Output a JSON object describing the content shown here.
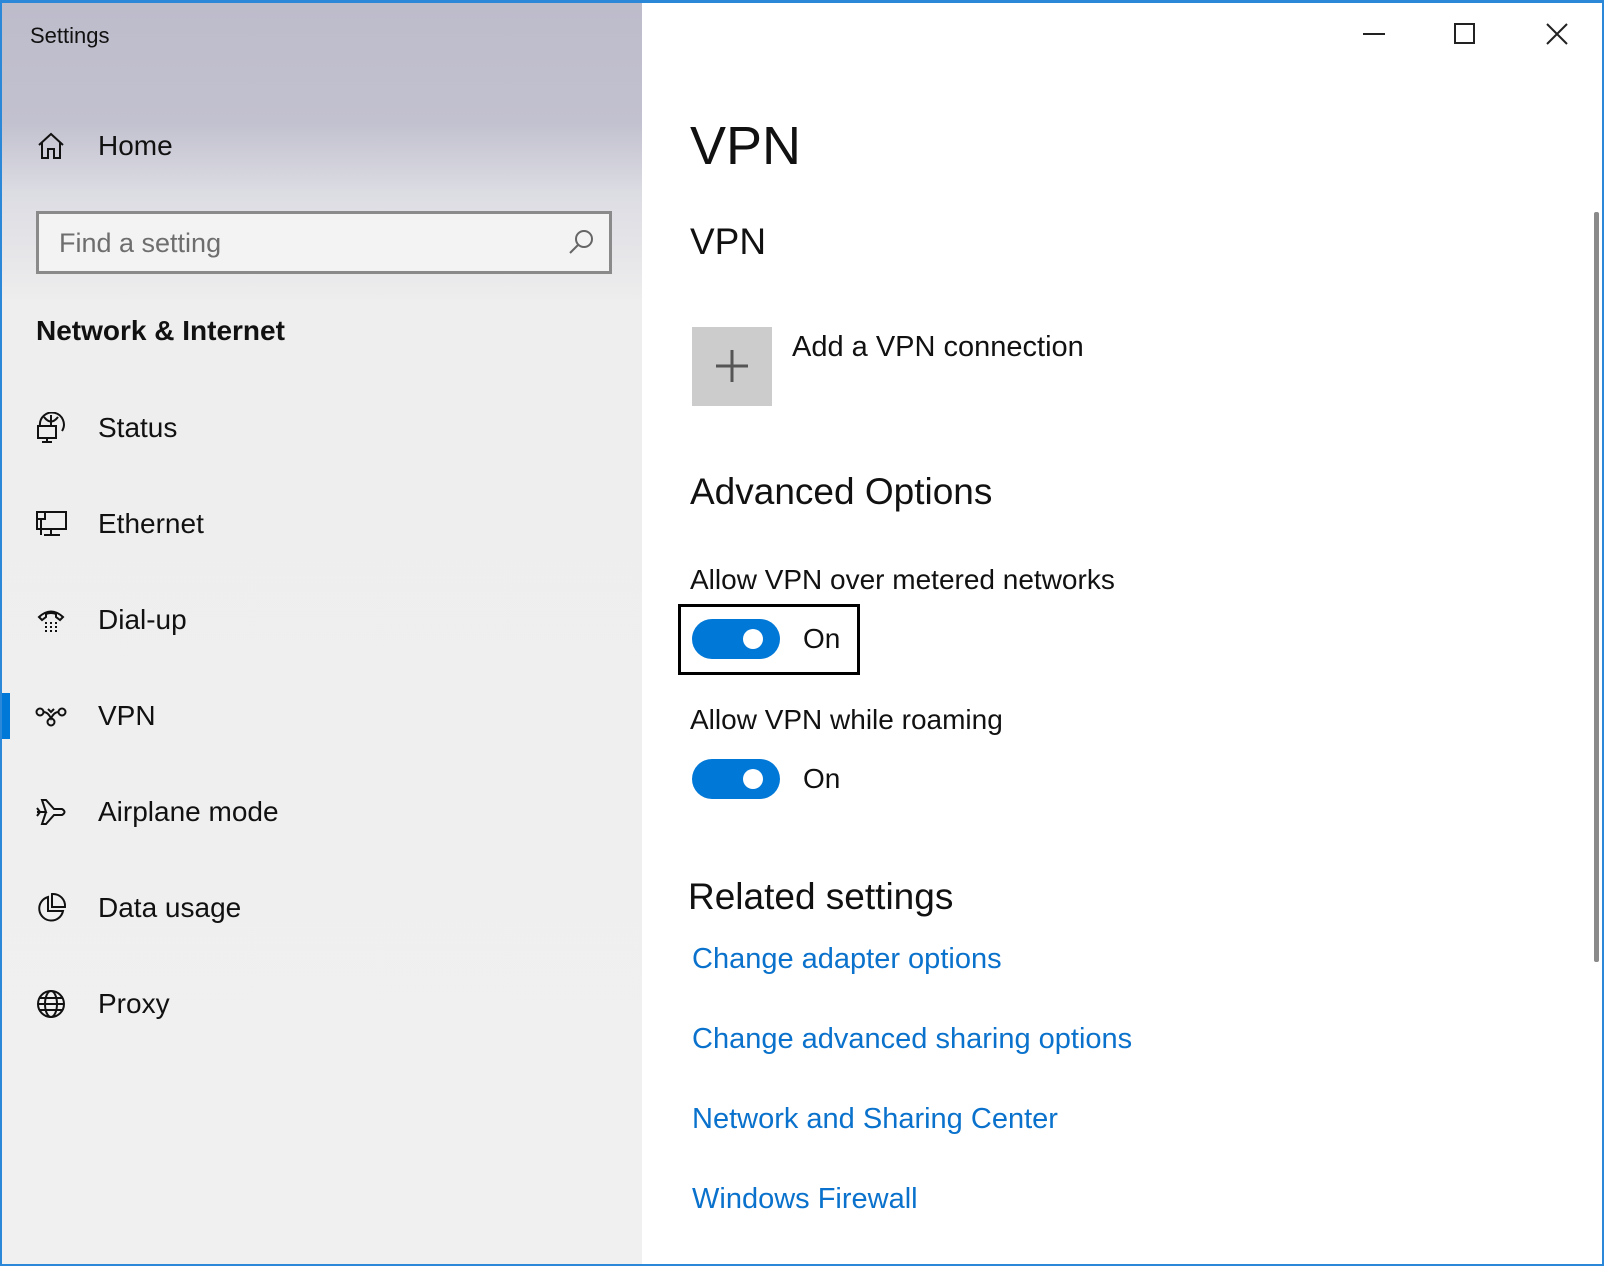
{
  "window": {
    "title": "Settings",
    "controls": {
      "minimize": "minimize-icon",
      "maximize": "maximize-icon",
      "close": "close-icon"
    }
  },
  "sidebar": {
    "home": {
      "label": "Home",
      "icon": "home-icon"
    },
    "search": {
      "placeholder": "Find a setting",
      "value": "",
      "icon": "search-icon"
    },
    "section_title": "Network & Internet",
    "items": [
      {
        "label": "Status",
        "icon": "status-globe-icon",
        "selected": false
      },
      {
        "label": "Ethernet",
        "icon": "ethernet-icon",
        "selected": false
      },
      {
        "label": "Dial-up",
        "icon": "dialup-phone-icon",
        "selected": false
      },
      {
        "label": "VPN",
        "icon": "vpn-icon",
        "selected": true
      },
      {
        "label": "Airplane mode",
        "icon": "airplane-icon",
        "selected": false
      },
      {
        "label": "Data usage",
        "icon": "data-usage-icon",
        "selected": false
      },
      {
        "label": "Proxy",
        "icon": "globe-icon",
        "selected": false
      }
    ]
  },
  "main": {
    "page_title": "VPN",
    "vpn_section": {
      "title": "VPN",
      "add_connection_label": "Add a VPN connection",
      "add_icon": "plus-icon"
    },
    "advanced": {
      "title": "Advanced Options",
      "options": [
        {
          "label": "Allow VPN over metered networks",
          "state": "On",
          "enabled": true,
          "focused": true
        },
        {
          "label": "Allow VPN while roaming",
          "state": "On",
          "enabled": true,
          "focused": false
        }
      ]
    },
    "related": {
      "title": "Related settings",
      "links": [
        "Change adapter options",
        "Change advanced sharing options",
        "Network and Sharing Center",
        "Windows Firewall"
      ]
    }
  },
  "colors": {
    "accent": "#0078d7",
    "link": "#0a72cc",
    "window_border": "#2b88d8",
    "add_button_bg": "#cccccc"
  }
}
